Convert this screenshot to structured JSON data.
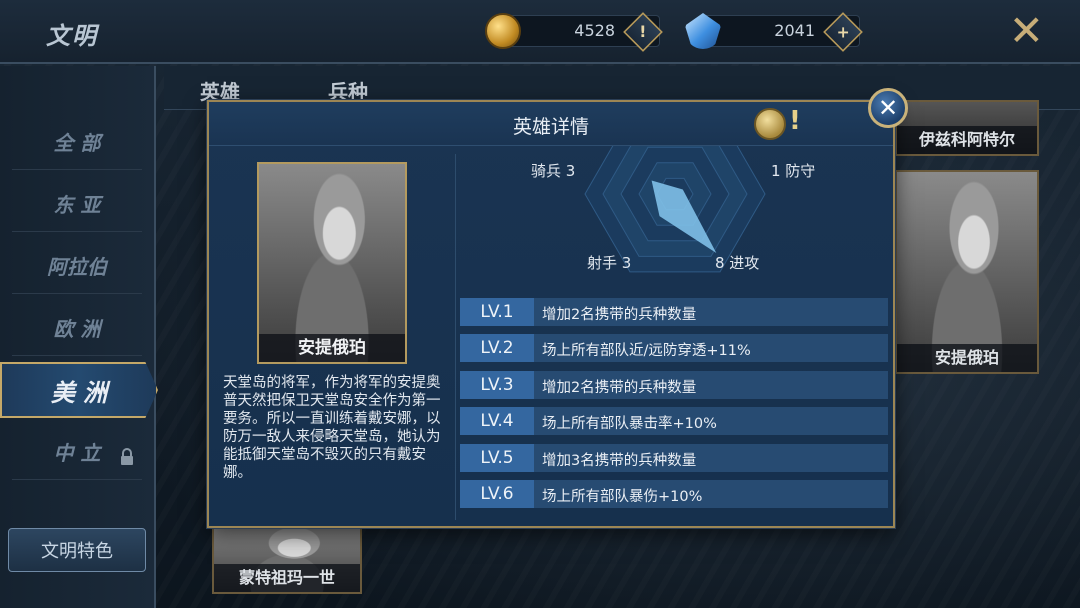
{
  "header": {
    "title": "文明",
    "gold": "4528",
    "gems": "2041"
  },
  "sidebar": {
    "items": [
      {
        "label": "全 部"
      },
      {
        "label": "东 亚"
      },
      {
        "label": "阿拉伯"
      },
      {
        "label": "欧 洲"
      },
      {
        "label": "美 洲",
        "active": true
      },
      {
        "label": "中 立",
        "locked": true
      }
    ],
    "feature_button": "文明特色"
  },
  "tabs": [
    "英雄",
    "兵种"
  ],
  "cards": {
    "top_right": "伊兹科阿特尔",
    "right": "安提俄珀",
    "bottom_left": "蒙特祖玛一世"
  },
  "modal": {
    "title": "英雄详情",
    "help_mark": "!",
    "hero_name": "安提俄珀",
    "description": "天堂岛的将军，作为将军的安提奥普天然把保卫天堂岛安全作为第一要务。所以一直训练着戴安娜，以防万一敌人来侵略天堂岛，她认为能抵御天堂岛不毁灭的只有戴安娜。",
    "stats": {
      "cavalry": "骑兵 3",
      "defense": "1 防守",
      "archer": "射手 3",
      "attack": "8 进攻"
    },
    "radar_values": {
      "attack": 8,
      "defense": 1,
      "archer": 3,
      "cavalry": 3,
      "max": 10
    },
    "levels": [
      {
        "tag": "LV.1",
        "text": "增加2名携带的兵种数量"
      },
      {
        "tag": "LV.2",
        "text": "场上所有部队近/远防穿透+11%"
      },
      {
        "tag": "LV.3",
        "text": "增加2名携带的兵种数量"
      },
      {
        "tag": "LV.4",
        "text": "场上所有部队暴击率+10%"
      },
      {
        "tag": "LV.5",
        "text": "增加3名携带的兵种数量"
      },
      {
        "tag": "LV.6",
        "text": "场上所有部队暴伤+10%"
      }
    ]
  },
  "colors": {
    "accent_gold": "#c4a868",
    "panel_blue": "#1a3452",
    "lv_tag": "#3467a0",
    "radar_fill": "#7fc0e8"
  }
}
